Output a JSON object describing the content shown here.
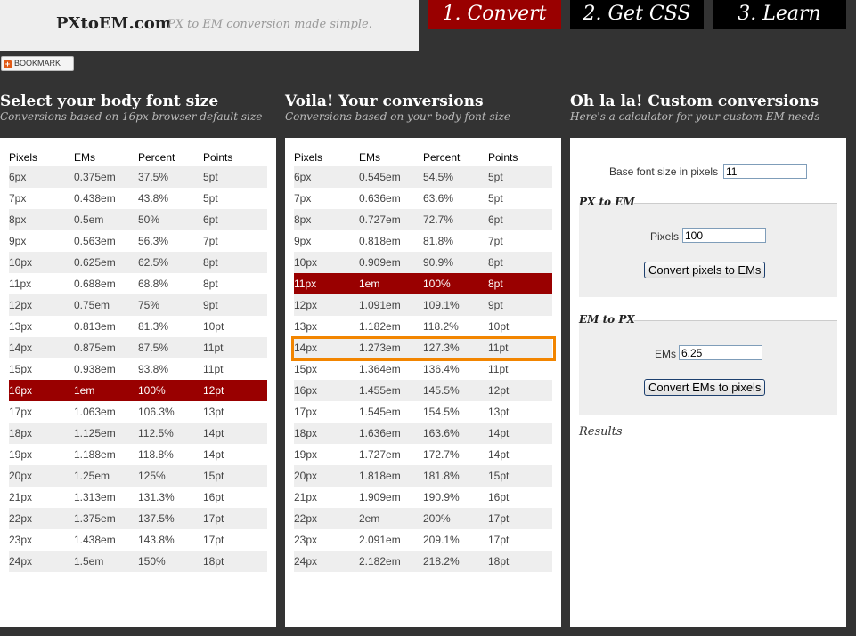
{
  "header": {
    "site_title": "PXtoEM.com",
    "tagline": "PX to EM conversion made simple.",
    "tabs": [
      {
        "label": "1. Convert",
        "active": true
      },
      {
        "label": "2. Get CSS"
      },
      {
        "label": "3. Learn"
      }
    ],
    "bookmark_label": "BOOKMARK"
  },
  "left": {
    "heading": "Select your body font size",
    "subheading": "Conversions based on 16px browser default size",
    "columns": [
      "Pixels",
      "EMs",
      "Percent",
      "Points"
    ],
    "rows": [
      [
        "6px",
        "0.375em",
        "37.5%",
        "5pt"
      ],
      [
        "7px",
        "0.438em",
        "43.8%",
        "5pt"
      ],
      [
        "8px",
        "0.5em",
        "50%",
        "6pt"
      ],
      [
        "9px",
        "0.563em",
        "56.3%",
        "7pt"
      ],
      [
        "10px",
        "0.625em",
        "62.5%",
        "8pt"
      ],
      [
        "11px",
        "0.688em",
        "68.8%",
        "8pt"
      ],
      [
        "12px",
        "0.75em",
        "75%",
        "9pt"
      ],
      [
        "13px",
        "0.813em",
        "81.3%",
        "10pt"
      ],
      [
        "14px",
        "0.875em",
        "87.5%",
        "11pt"
      ],
      [
        "15px",
        "0.938em",
        "93.8%",
        "11pt"
      ],
      [
        "16px",
        "1em",
        "100%",
        "12pt"
      ],
      [
        "17px",
        "1.063em",
        "106.3%",
        "13pt"
      ],
      [
        "18px",
        "1.125em",
        "112.5%",
        "14pt"
      ],
      [
        "19px",
        "1.188em",
        "118.8%",
        "14pt"
      ],
      [
        "20px",
        "1.25em",
        "125%",
        "15pt"
      ],
      [
        "21px",
        "1.313em",
        "131.3%",
        "16pt"
      ],
      [
        "22px",
        "1.375em",
        "137.5%",
        "17pt"
      ],
      [
        "23px",
        "1.438em",
        "143.8%",
        "17pt"
      ],
      [
        "24px",
        "1.5em",
        "150%",
        "18pt"
      ]
    ]
  },
  "middle": {
    "heading": "Voila! Your conversions",
    "subheading": "Conversions based on your body font size",
    "columns": [
      "Pixels",
      "EMs",
      "Percent",
      "Points"
    ],
    "rows": [
      [
        "6px",
        "0.545em",
        "54.5%",
        "5pt"
      ],
      [
        "7px",
        "0.636em",
        "63.6%",
        "5pt"
      ],
      [
        "8px",
        "0.727em",
        "72.7%",
        "6pt"
      ],
      [
        "9px",
        "0.818em",
        "81.8%",
        "7pt"
      ],
      [
        "10px",
        "0.909em",
        "90.9%",
        "8pt"
      ],
      [
        "11px",
        "1em",
        "100%",
        "8pt"
      ],
      [
        "12px",
        "1.091em",
        "109.1%",
        "9pt"
      ],
      [
        "13px",
        "1.182em",
        "118.2%",
        "10pt"
      ],
      [
        "14px",
        "1.273em",
        "127.3%",
        "11pt"
      ],
      [
        "15px",
        "1.364em",
        "136.4%",
        "11pt"
      ],
      [
        "16px",
        "1.455em",
        "145.5%",
        "12pt"
      ],
      [
        "17px",
        "1.545em",
        "154.5%",
        "13pt"
      ],
      [
        "18px",
        "1.636em",
        "163.6%",
        "14pt"
      ],
      [
        "19px",
        "1.727em",
        "172.7%",
        "14pt"
      ],
      [
        "20px",
        "1.818em",
        "181.8%",
        "15pt"
      ],
      [
        "21px",
        "1.909em",
        "190.9%",
        "16pt"
      ],
      [
        "22px",
        "2em",
        "200%",
        "17pt"
      ],
      [
        "23px",
        "2.091em",
        "209.1%",
        "17pt"
      ],
      [
        "24px",
        "2.182em",
        "218.2%",
        "18pt"
      ]
    ]
  },
  "right": {
    "heading": "Oh la la! Custom conversions",
    "subheading": "Here's a calculator for your custom EM needs",
    "base_label": "Base font size in pixels",
    "base_value": "11",
    "px_to_em": {
      "legend": "PX to EM",
      "label": "Pixels",
      "value": "100",
      "button": "Convert pixels to EMs"
    },
    "em_to_px": {
      "legend": "EM to PX",
      "label": "EMs",
      "value": "6.25",
      "button": "Convert EMs to pixels"
    },
    "results_label": "Results"
  },
  "colors": {
    "background": "#333333",
    "accent_red": "#990000",
    "highlight_orange": "#f28500"
  }
}
